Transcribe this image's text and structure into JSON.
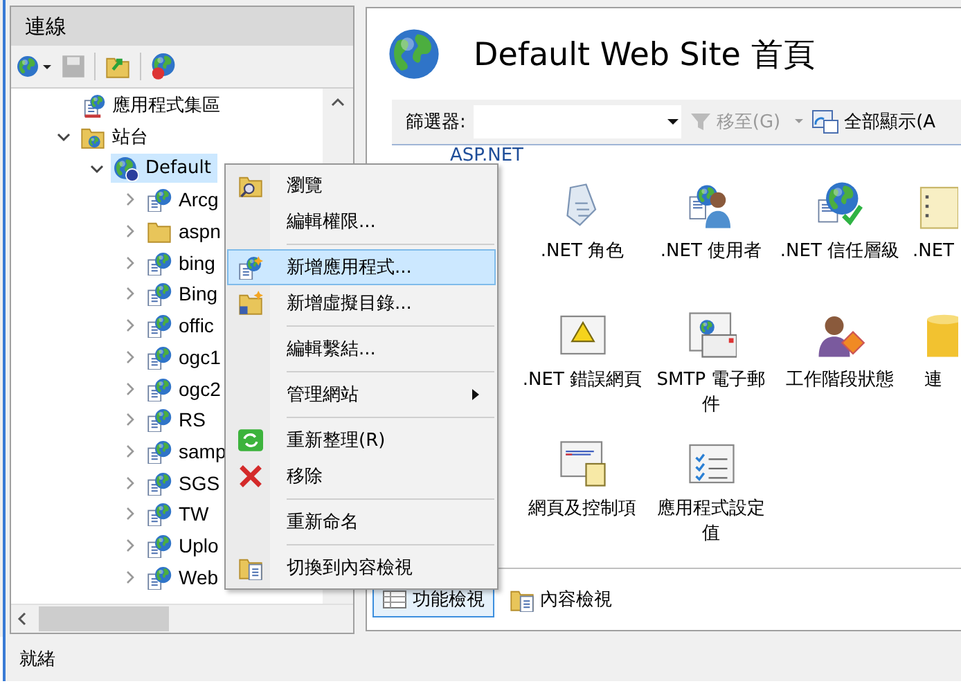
{
  "left_panel": {
    "title": "連線",
    "tree": [
      {
        "label": "應用程式集區",
        "kind": "app_pool",
        "selected": false
      },
      {
        "label": "站台",
        "kind": "sites",
        "selected": false,
        "expanded": true,
        "children": [
          {
            "label": "Default",
            "kind": "site",
            "selected": true,
            "expanded": true,
            "children": [
              {
                "label": "Arcg",
                "kind": "application",
                "selected": false,
                "expanded": false
              },
              {
                "label": "aspn",
                "kind": "folder",
                "selected": false,
                "expanded": false
              },
              {
                "label": "bing",
                "kind": "application",
                "selected": false,
                "expanded": false
              },
              {
                "label": "Bing",
                "kind": "application",
                "selected": false,
                "expanded": false
              },
              {
                "label": "offic",
                "kind": "application",
                "selected": false,
                "expanded": false
              },
              {
                "label": "ogc1",
                "kind": "application",
                "selected": false,
                "expanded": false
              },
              {
                "label": "ogc2",
                "kind": "application",
                "selected": false,
                "expanded": false
              },
              {
                "label": "RS",
                "kind": "application",
                "selected": false,
                "expanded": false
              },
              {
                "label": "samp",
                "kind": "application",
                "selected": false,
                "expanded": false
              },
              {
                "label": "SGS",
                "kind": "application",
                "selected": false,
                "expanded": false
              },
              {
                "label": "TW",
                "kind": "application",
                "selected": false,
                "expanded": false
              },
              {
                "label": "Uplo",
                "kind": "application",
                "selected": false,
                "expanded": false
              },
              {
                "label": "Web",
                "kind": "application",
                "selected": false,
                "expanded": false
              }
            ]
          }
        ]
      }
    ]
  },
  "content": {
    "title": "Default Web Site 首頁",
    "filter": {
      "label": "篩選器:",
      "go_to": {
        "label": "移至(G)",
        "disabled": true
      },
      "show_all": "全部顯示(A"
    },
    "group": "ASP.NET",
    "features": [
      {
        "label": ".NET 角色"
      },
      {
        "label": ".NET 使用者"
      },
      {
        "label": ".NET 信任層級"
      },
      {
        "label": ".NET"
      },
      {
        "label": ".NET 錯誤網頁"
      },
      {
        "label": "SMTP 電子郵件"
      },
      {
        "label": "工作階段狀態"
      },
      {
        "label": "連"
      },
      {
        "label": "網頁及控制項"
      },
      {
        "label": "應用程式設定值"
      }
    ],
    "views": [
      {
        "label": "功能檢視",
        "selected": true
      },
      {
        "label": "內容檢視",
        "selected": false
      }
    ]
  },
  "context_menu": {
    "groups": [
      [
        {
          "label": "瀏覽",
          "selected": false,
          "submenu": false
        },
        {
          "label": "編輯權限...",
          "selected": false,
          "submenu": false
        }
      ],
      [
        {
          "label": "新增應用程式...",
          "selected": true,
          "submenu": false
        },
        {
          "label": "新增虛擬目錄...",
          "selected": false,
          "submenu": false
        }
      ],
      [
        {
          "label": "編輯繫結...",
          "selected": false,
          "submenu": false
        }
      ],
      [
        {
          "label": "管理網站",
          "selected": false,
          "submenu": true
        }
      ],
      [
        {
          "label": "重新整理(R)",
          "selected": false,
          "submenu": false
        },
        {
          "label": "移除",
          "selected": false,
          "submenu": false
        }
      ],
      [
        {
          "label": "重新命名",
          "selected": false,
          "submenu": false
        }
      ],
      [
        {
          "label": "切換到內容檢視",
          "selected": false,
          "submenu": false
        }
      ]
    ]
  },
  "status_bar": "就緒"
}
